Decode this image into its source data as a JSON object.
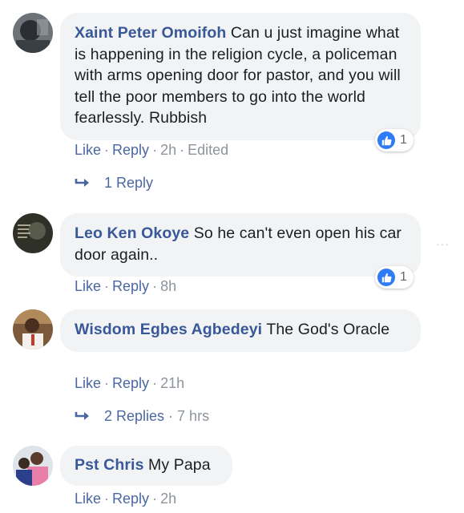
{
  "comments": [
    {
      "author": "Xaint Peter Omoifoh",
      "text": "Can u just imagine what is happening in the religion cycle, a policeman with arms opening door for pastor, and you will tell the poor members to go into the world fearlessly. Rubbish",
      "like": "Like",
      "reply": "Reply",
      "time": "2h",
      "edited": "Edited",
      "reactions": "1",
      "replies_label": "1 Reply"
    },
    {
      "author": "Leo Ken Okoye",
      "text": "So he can't even open his car door again..",
      "like": "Like",
      "reply": "Reply",
      "time": "8h",
      "reactions": "1"
    },
    {
      "author": "Wisdom Egbes Agbedeyi",
      "text": "The God's Oracle",
      "like": "Like",
      "reply": "Reply",
      "time": "21h",
      "replies_label": "2 Replies",
      "replies_time": "7 hrs"
    },
    {
      "author": "Pst Chris",
      "text": "My Papa",
      "like": "Like",
      "reply": "Reply",
      "time": "2h"
    }
  ],
  "separator": "·",
  "more_options": "···",
  "colors": {
    "name": "#385898",
    "link": "#4b67a1",
    "meta": "#8d949e",
    "bubble": "#f2f3f5",
    "like_badge": "#2e7bf6"
  }
}
